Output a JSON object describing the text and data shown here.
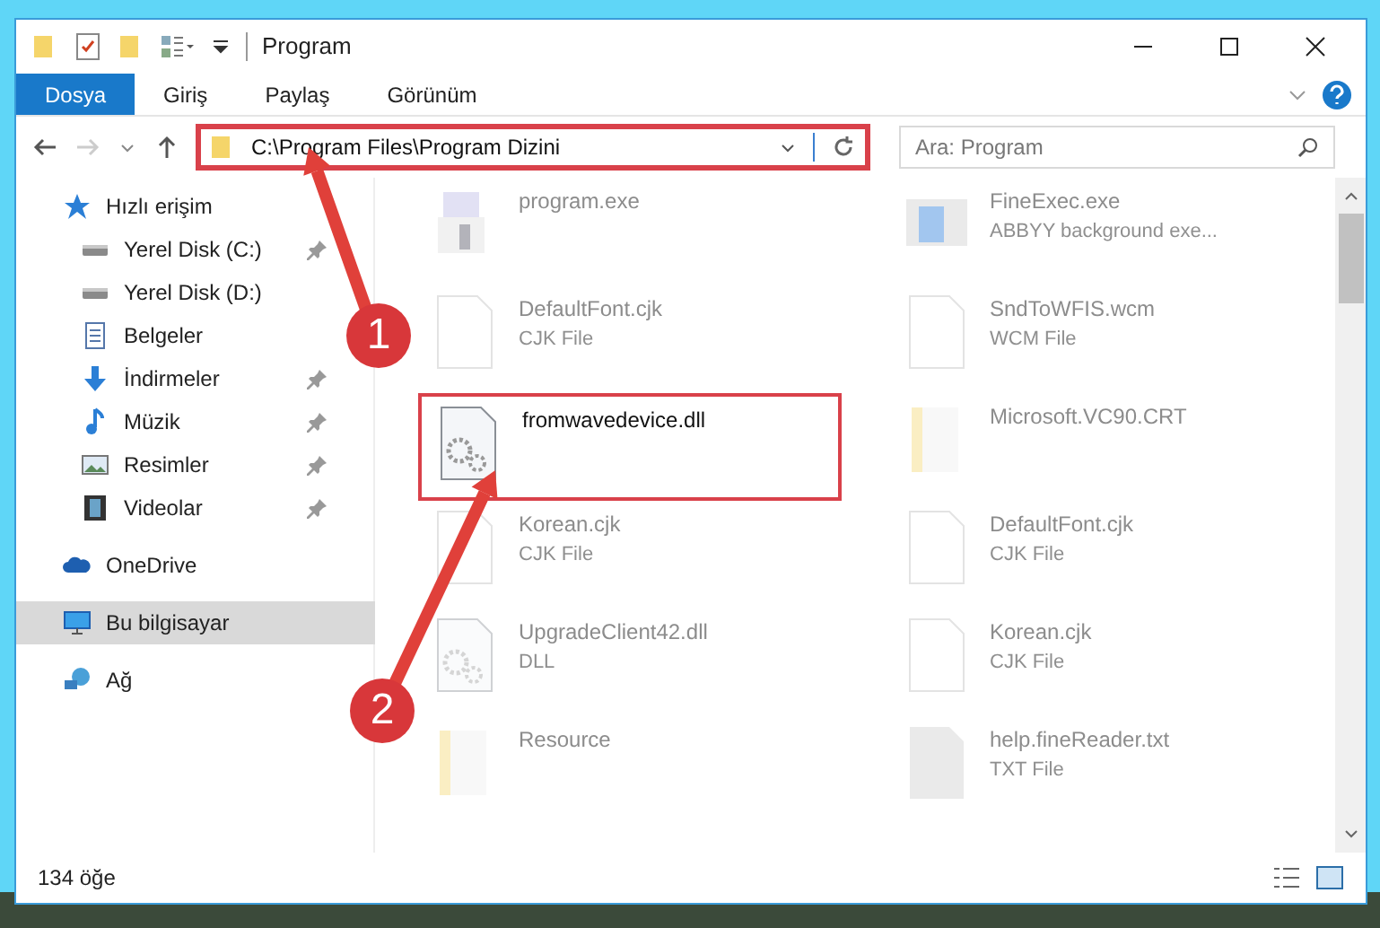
{
  "window": {
    "title": "Program"
  },
  "ribbon_tabs": [
    {
      "label": "Dosya",
      "selected": true
    },
    {
      "label": "Giriş",
      "selected": false
    },
    {
      "label": "Paylaş",
      "selected": false
    },
    {
      "label": "Görünüm",
      "selected": false
    }
  ],
  "address_bar": {
    "path": "C:\\Program Files\\Program Dizini"
  },
  "search": {
    "placeholder": "Ara: Program"
  },
  "sidebar": {
    "items": [
      {
        "label": "Hızlı erişim",
        "kind": "star",
        "selected": false,
        "children": [
          {
            "label": "Yerel Disk (C:)",
            "kind": "disk",
            "pinned": true,
            "selected": false
          },
          {
            "label": "Yerel Disk (D:)",
            "kind": "disk",
            "pinned": false,
            "selected": false
          },
          {
            "label": "Belgeler",
            "kind": "documents",
            "pinned": false,
            "selected": false
          },
          {
            "label": "İndirmeler",
            "kind": "downloads",
            "pinned": true,
            "selected": false
          },
          {
            "label": "Müzik",
            "kind": "music",
            "pinned": true,
            "selected": false
          },
          {
            "label": "Resimler",
            "kind": "pictures",
            "pinned": true,
            "selected": false
          },
          {
            "label": "Videolar",
            "kind": "videos",
            "pinned": true,
            "selected": false
          }
        ]
      },
      {
        "label": "OneDrive",
        "kind": "cloud",
        "selected": false
      },
      {
        "label": "Bu bilgisayar",
        "kind": "computer",
        "selected": true
      },
      {
        "label": "Ağ",
        "kind": "network",
        "selected": false
      }
    ]
  },
  "files": [
    {
      "name": "program.exe",
      "kind": "exe",
      "highlighted": false
    },
    {
      "name": "FineExec.exe",
      "type": "ABBYY background exe...",
      "kind": "app",
      "highlighted": false
    },
    {
      "name": "DefaultFont.cjk",
      "type": "CJK File",
      "kind": "file",
      "highlighted": false
    },
    {
      "name": "SndToWFIS.wcm",
      "type": "WCM File",
      "kind": "file",
      "highlighted": false
    },
    {
      "name": "fromwavedevice.dll",
      "kind": "dll",
      "highlighted": true
    },
    {
      "name": "Microsoft.VC90.CRT",
      "kind": "folder",
      "highlighted": false
    },
    {
      "name": "Korean.cjk",
      "type": "CJK File",
      "kind": "file",
      "highlighted": false
    },
    {
      "name": "DefaultFont.cjk",
      "type": "CJK File",
      "kind": "file",
      "highlighted": false
    },
    {
      "name": "UpgradeClient42.dll",
      "type": "DLL",
      "kind": "dll",
      "highlighted": false
    },
    {
      "name": "Korean.cjk",
      "type": "CJK File",
      "kind": "file",
      "highlighted": false
    },
    {
      "name": "Resource",
      "kind": "folder",
      "highlighted": false
    },
    {
      "name": "help.fineReader.txt",
      "type": "TXT File",
      "kind": "txt",
      "highlighted": false
    }
  ],
  "status_bar": {
    "count": "134 öğe"
  },
  "annotations": [
    {
      "label": "1"
    },
    {
      "label": "2"
    }
  ]
}
